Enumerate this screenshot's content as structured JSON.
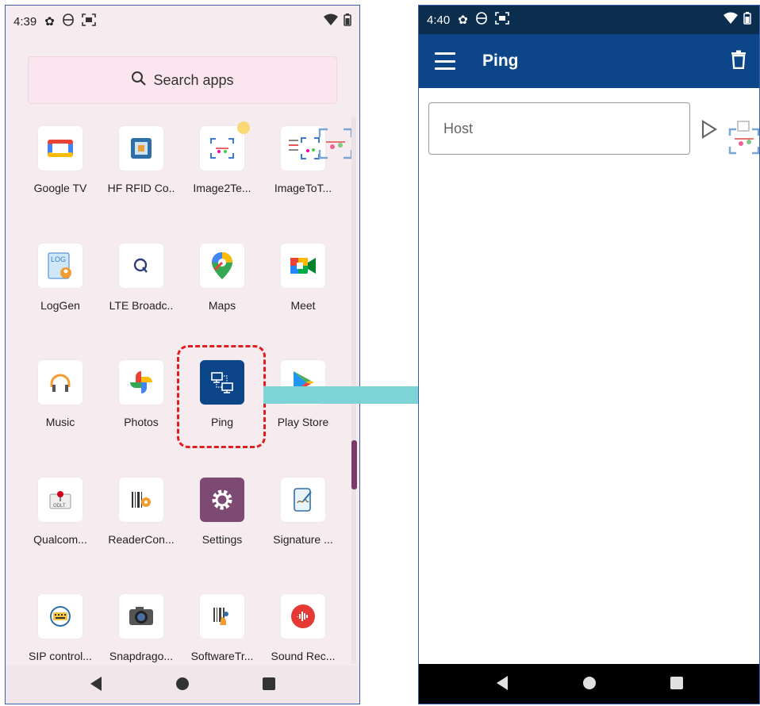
{
  "left_phone": {
    "status": {
      "time": "4:39"
    },
    "search": {
      "placeholder": "Search apps"
    },
    "apps": [
      {
        "label": "Google TV",
        "icon": "google-tv-icon"
      },
      {
        "label": "HF RFID Co..",
        "icon": "rfid-icon"
      },
      {
        "label": "Image2Te...",
        "icon": "image-scan-icon"
      },
      {
        "label": "ImageToT...",
        "icon": "image-to-text-icon"
      },
      {
        "label": "LogGen",
        "icon": "log-icon"
      },
      {
        "label": "LTE Broadc..",
        "icon": "lte-broadcast-icon"
      },
      {
        "label": "Maps",
        "icon": "maps-pin-icon"
      },
      {
        "label": "Meet",
        "icon": "meet-camera-icon"
      },
      {
        "label": "Music",
        "icon": "headphones-icon"
      },
      {
        "label": "Photos",
        "icon": "pinwheel-icon"
      },
      {
        "label": "Ping",
        "icon": "network-ping-icon"
      },
      {
        "label": "Play Store",
        "icon": "play-store-icon"
      },
      {
        "label": "Qualcom...",
        "icon": "qualcomm-icon"
      },
      {
        "label": "ReaderCon...",
        "icon": "barcode-reader-icon"
      },
      {
        "label": "Settings",
        "icon": "gear-icon"
      },
      {
        "label": "Signature ...",
        "icon": "signature-icon"
      },
      {
        "label": "SIP control...",
        "icon": "keyboard-icon"
      },
      {
        "label": "Snapdrago...",
        "icon": "camera-icon"
      },
      {
        "label": "SoftwareTr...",
        "icon": "software-trigger-icon"
      },
      {
        "label": "Sound Rec...",
        "icon": "sound-recorder-icon"
      }
    ]
  },
  "right_phone": {
    "status": {
      "time": "4:40"
    },
    "appbar": {
      "title": "Ping"
    },
    "host_input": {
      "placeholder": "Host",
      "value": ""
    }
  },
  "colors": {
    "appbar": "#0c4688",
    "statusbar_dark": "#0b2e4f",
    "highlight": "#e11d1d",
    "arrow": "#7ed3d6",
    "launcher_bg": "#f6ecf0"
  }
}
